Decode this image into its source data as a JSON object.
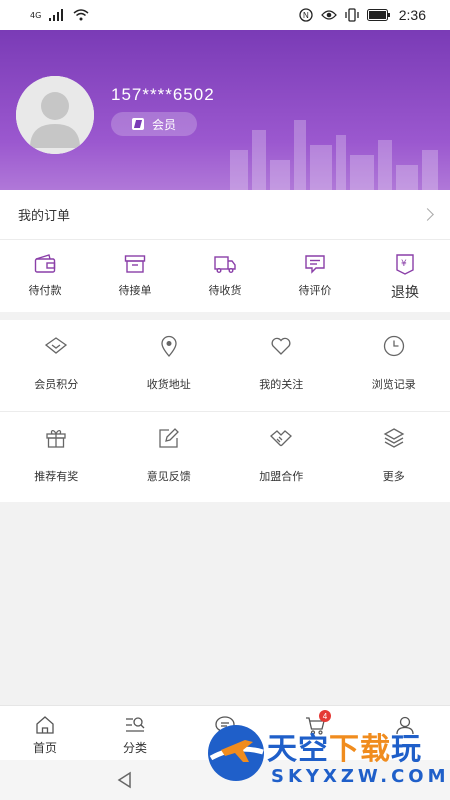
{
  "status_bar": {
    "network": "4G",
    "time": "2:36"
  },
  "profile": {
    "phone": "157****6502",
    "member_label": "会员"
  },
  "orders": {
    "title": "我的订单",
    "items": [
      {
        "label": "待付款",
        "icon": "wallet-icon"
      },
      {
        "label": "待接单",
        "icon": "box-icon"
      },
      {
        "label": "待收货",
        "icon": "truck-icon"
      },
      {
        "label": "待评价",
        "icon": "comment-icon"
      },
      {
        "label": "退换",
        "icon": "refund-icon"
      }
    ]
  },
  "services": {
    "row1": [
      {
        "label": "会员积分",
        "icon": "diamond-icon"
      },
      {
        "label": "收货地址",
        "icon": "location-pin-icon"
      },
      {
        "label": "我的关注",
        "icon": "heart-icon"
      },
      {
        "label": "浏览记录",
        "icon": "clock-icon"
      }
    ],
    "row2": [
      {
        "label": "推荐有奖",
        "icon": "gift-icon"
      },
      {
        "label": "意见反馈",
        "icon": "edit-icon"
      },
      {
        "label": "加盟合作",
        "icon": "handshake-icon"
      },
      {
        "label": "更多",
        "icon": "layers-icon"
      }
    ]
  },
  "tabbar": {
    "items": [
      {
        "label": "首页",
        "icon": "home-icon"
      },
      {
        "label": "分类",
        "icon": "category-search-icon"
      },
      {
        "label": "",
        "icon": "chat-icon"
      },
      {
        "label": "",
        "icon": "cart-icon",
        "badge": "4"
      },
      {
        "label": "",
        "icon": "user-icon"
      }
    ]
  },
  "watermark": {
    "title_blue": "天空",
    "title_orange": "下载",
    "title_blue2": "玩",
    "subtitle": "SKYXZW.COM"
  },
  "colors": {
    "header_gradient_top": "#7a3bb6",
    "header_gradient_bottom": "#b078d8",
    "accent_purple": "#8a3fa8",
    "badge_red": "#e53935"
  }
}
